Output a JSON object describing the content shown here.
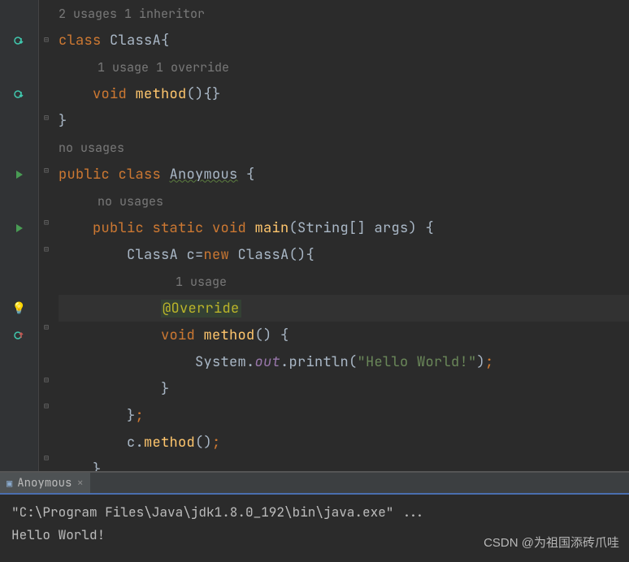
{
  "hints": {
    "top": "2 usages   1 inheritor",
    "usage1_override1": "1 usage   1 override",
    "no_usages": "no usages",
    "usage1": "1 usage"
  },
  "code": {
    "classA_open": {
      "kw_class": "class ",
      "name": "ClassA",
      "brace": "{"
    },
    "method_void": {
      "kw_void": "void ",
      "name": "method",
      "parens": "()",
      "braces": "{}"
    },
    "close_brace": "}",
    "public_class": {
      "kw_public": "public ",
      "kw_class": "class ",
      "name": "Anoymous",
      "rest": " {"
    },
    "main_sig": {
      "kw_public": "public ",
      "kw_static": "static ",
      "kw_void": "void ",
      "name": "main",
      "args": "(String[] args) {"
    },
    "classA_new": {
      "pre": "ClassA c=",
      "kw_new": "new ",
      "ctor": "ClassA",
      "rest": "(){"
    },
    "override_ann": "@Override",
    "method2": {
      "kw_void": "void ",
      "name": "method",
      "rest": "() {"
    },
    "println": {
      "obj": "System.",
      "field": "out",
      "dot": ".println(",
      "str": "\"Hello World!\"",
      "end": ")",
      "semi": ";"
    },
    "close_brace2": "}",
    "close_semi": {
      "brace": "}",
      "semi": ";"
    },
    "call_method": {
      "pre": "c.",
      "name": "method",
      "rest": "()",
      "semi": ";"
    }
  },
  "indent": "    ",
  "tab": {
    "name": "Anoymous"
  },
  "terminal": {
    "command": "\"C:\\Program Files\\Java\\jdk1.8.0_192\\bin\\java.exe\" ...",
    "output": "Hello World!"
  },
  "watermark": "CSDN @为祖国添砖爪哇"
}
